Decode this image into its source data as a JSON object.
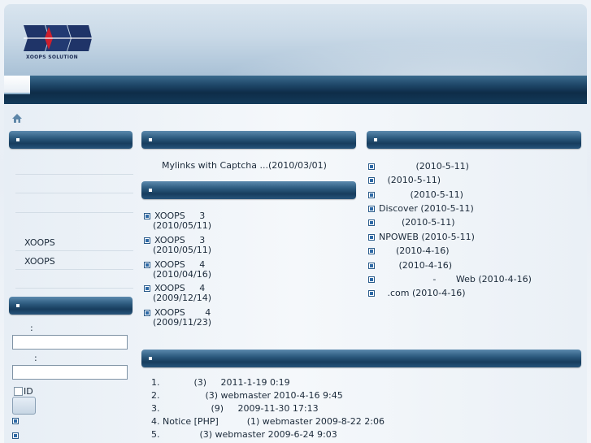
{
  "logo": {
    "caption": "XOOPS SOLUTION"
  },
  "left_menu": {
    "items": [
      "",
      "",
      "",
      "XOOPS",
      "XOOPS",
      ""
    ]
  },
  "login": {
    "username_label": ":",
    "password_label": ":",
    "remember_label": "ID"
  },
  "center_links": {
    "item": "Mylinks with Captcha ...(2010/03/01)"
  },
  "center_news": {
    "items": [
      {
        "line1": "XOOPS     3",
        "line2": "(2010/05/11)"
      },
      {
        "line1": "XOOPS     3",
        "line2": "(2010/05/11)"
      },
      {
        "line1": "XOOPS     4",
        "line2": "(2010/04/16)"
      },
      {
        "line1": "XOOPS     4",
        "line2": "(2009/12/14)"
      },
      {
        "line1": "XOOPS       4",
        "line2": "(2009/11/23)"
      }
    ]
  },
  "right_list": {
    "items": [
      "             (2010-5-11)",
      "   (2010-5-11)",
      "           (2010-5-11)",
      "Discover (2010-5-11)",
      "        (2010-5-11)",
      "NPOWEB (2010-5-11)",
      "      (2010-4-16)",
      "       (2010-4-16)",
      "                   -       Web (2010-4-16)",
      "   .com (2010-4-16)"
    ]
  },
  "forum": {
    "items": [
      {
        "num": "1.",
        "text": "           (3)     2011-1-19 0:19"
      },
      {
        "num": "2.",
        "text": "               (3) webmaster 2010-4-16 9:45"
      },
      {
        "num": "3.",
        "text": "                 (9)     2009-11-30 17:13"
      },
      {
        "num": "4.",
        "text": "Notice [PHP]          (1) webmaster 2009-8-22 2:06"
      },
      {
        "num": "5.",
        "text": "             (3) webmaster 2009-6-24 9:03"
      }
    ]
  },
  "colors": {
    "header_bar": "#173d5e",
    "accent": "#2e6aa7"
  }
}
